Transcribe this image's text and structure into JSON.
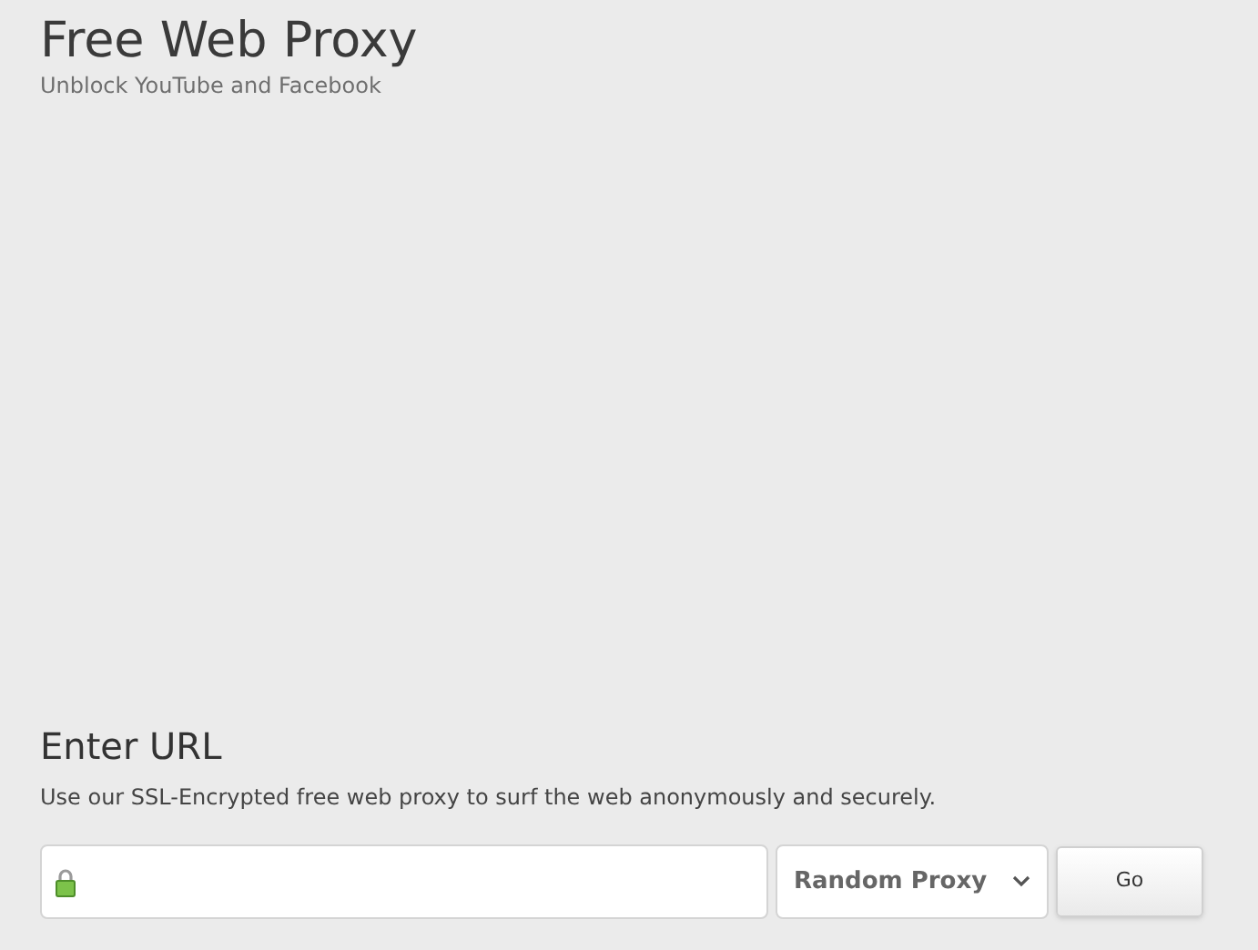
{
  "header": {
    "title": "Free Web Proxy",
    "subtitle": "Unblock YouTube and Facebook"
  },
  "form": {
    "heading": "Enter URL",
    "description": "Use our SSL-Encrypted free web proxy to surf the web anonymously and securely.",
    "proxy_select": "Random Proxy",
    "button": "Go"
  }
}
